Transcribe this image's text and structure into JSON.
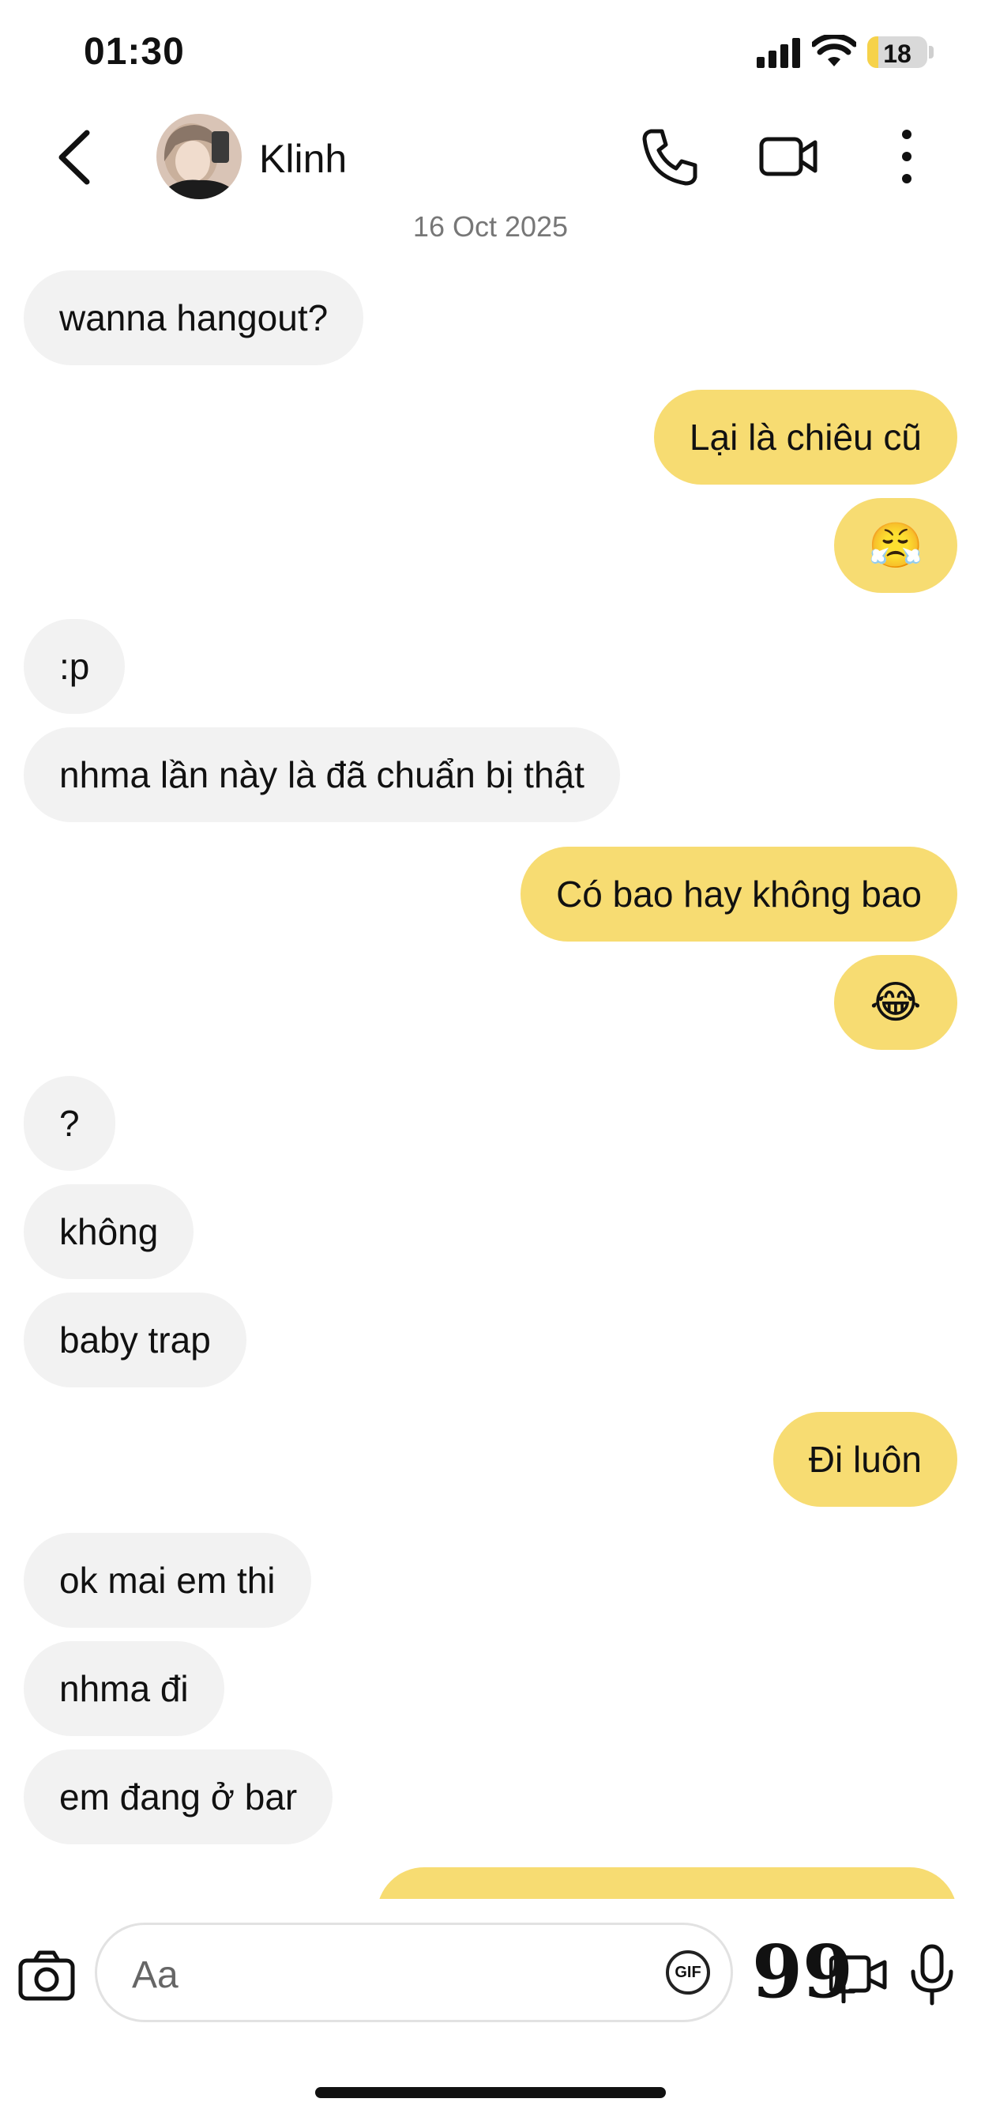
{
  "status_bar": {
    "time": "01:30",
    "battery_level": "18",
    "battery_fraction": 0.18
  },
  "header": {
    "back_icon": "chevron-left-icon",
    "contact_name": "Klinh",
    "actions": [
      "phone-icon",
      "video-camera-icon",
      "more-vertical-icon"
    ]
  },
  "conversation": {
    "date": "16 Oct 2025",
    "messages": [
      {
        "side": "in",
        "text": "wanna hangout?"
      },
      {
        "side": "out",
        "text": "Lại là chiêu cũ"
      },
      {
        "side": "out",
        "text": "😤"
      },
      {
        "side": "in",
        "text": ":p"
      },
      {
        "side": "in",
        "text": "nhma lần này là đã chuẩn bị thật"
      },
      {
        "side": "out",
        "text": "Có bao hay không bao"
      },
      {
        "side": "out",
        "text": "😂"
      },
      {
        "side": "in",
        "text": "?"
      },
      {
        "side": "in",
        "text": "không"
      },
      {
        "side": "in",
        "text": "baby trap"
      },
      {
        "side": "out",
        "text": "Đi luôn"
      },
      {
        "side": "in",
        "text": "ok mai em thi"
      },
      {
        "side": "in",
        "text": "nhma đi"
      },
      {
        "side": "in",
        "text": "em đang ở bar"
      }
    ]
  },
  "composer": {
    "placeholder": "Aa",
    "gif_label": "GIF",
    "quote_label": "99",
    "icons": [
      "camera-icon",
      "gif-icon",
      "quote-icon",
      "video-message-icon",
      "microphone-icon"
    ]
  },
  "colors": {
    "outgoing_bubble": "#f7dc72",
    "incoming_bubble": "#f2f2f2",
    "battery_fill": "#f6d24a"
  }
}
